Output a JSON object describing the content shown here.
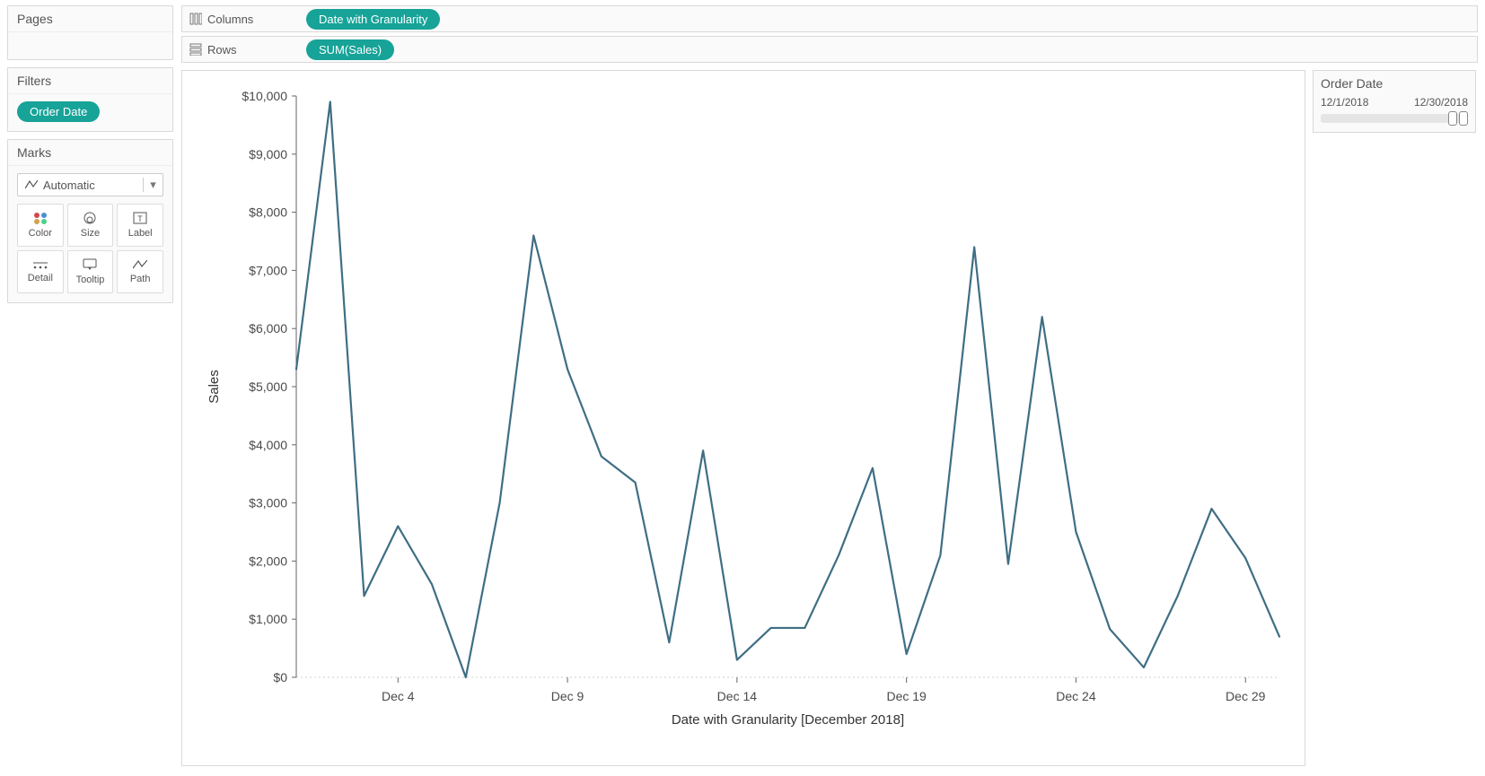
{
  "sidebar": {
    "pages_label": "Pages",
    "filters_label": "Filters",
    "filter_pill": "Order Date",
    "marks_label": "Marks",
    "marks_select_value": "Automatic",
    "cards": {
      "color": "Color",
      "size": "Size",
      "label": "Label",
      "detail": "Detail",
      "tooltip": "Tooltip",
      "path": "Path"
    }
  },
  "shelves": {
    "columns_label": "Columns",
    "rows_label": "Rows",
    "columns_pill": "Date with Granularity",
    "rows_pill": "SUM(Sales)"
  },
  "right_card": {
    "title": "Order Date",
    "start": "12/1/2018",
    "end": "12/30/2018"
  },
  "chart_data": {
    "type": "line",
    "ylabel": "Sales",
    "xlabel": "Date with Granularity [December 2018]",
    "xlim": [
      1,
      30
    ],
    "ylim": [
      0,
      10000
    ],
    "y_ticks": [
      0,
      1000,
      2000,
      3000,
      4000,
      5000,
      6000,
      7000,
      8000,
      9000,
      10000
    ],
    "y_tick_labels": [
      "$0",
      "$1,000",
      "$2,000",
      "$3,000",
      "$4,000",
      "$5,000",
      "$6,000",
      "$7,000",
      "$8,000",
      "$9,000",
      "$10,000"
    ],
    "x_tick_values": [
      4,
      9,
      14,
      19,
      24,
      29
    ],
    "x_tick_labels": [
      "Dec 4",
      "Dec 9",
      "Dec 14",
      "Dec 19",
      "Dec 24",
      "Dec 29"
    ],
    "x": [
      1,
      2,
      3,
      4,
      5,
      6,
      7,
      8,
      9,
      10,
      11,
      12,
      13,
      14,
      15,
      16,
      17,
      18,
      19,
      20,
      21,
      22,
      23,
      24,
      25,
      26,
      27,
      28,
      29,
      30
    ],
    "values": [
      5300,
      9900,
      1400,
      2600,
      1600,
      0,
      3000,
      7600,
      5300,
      3800,
      3350,
      600,
      3900,
      300,
      850,
      850,
      2100,
      3600,
      400,
      2100,
      7400,
      1950,
      6200,
      2500,
      830,
      170,
      1400,
      2900,
      2050,
      700
    ],
    "line_color": "#3f6e84"
  }
}
